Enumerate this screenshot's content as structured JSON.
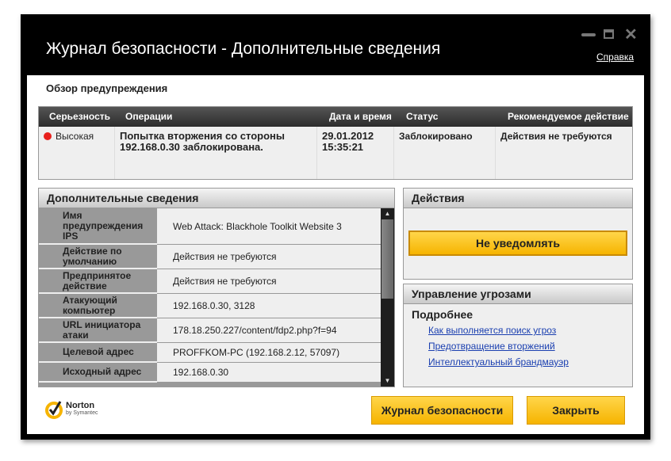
{
  "window": {
    "title": "Журнал безопасности - Дополнительные сведения",
    "help_link": "Справка"
  },
  "overview": {
    "heading": "Обзор предупреждения",
    "columns": [
      "Серьезность",
      "Операции",
      "Дата и время",
      "Статус",
      "Рекомендуемое действие"
    ],
    "row": {
      "severity": "Высокая",
      "severity_color": "#e8201c",
      "operation": "Попытка вторжения со стороны 192.168.0.30 заблокирована.",
      "date": "29.01.2012",
      "time": "15:35:21",
      "status": "Заблокировано",
      "recommended": "Действия не требуются"
    }
  },
  "details": {
    "heading": "Дополнительные сведения",
    "rows": [
      {
        "label": "Имя предупреждения IPS",
        "value": "Web Attack: Blackhole Toolkit Website 3"
      },
      {
        "label": "Действие по умолчанию",
        "value": "Действия не требуются"
      },
      {
        "label": "Предпринятое действие",
        "value": "Действия не требуются"
      },
      {
        "label": "Атакующий компьютер",
        "value": "192.168.0.30, 3128"
      },
      {
        "label": "URL инициатора атаки",
        "value": "178.18.250.227/content/fdp2.php?f=94"
      },
      {
        "label": "Целевой адрес",
        "value": "PROFFKOM-PC (192.168.2.12, 57097)"
      },
      {
        "label": "Исходный адрес",
        "value": "192.168.0.30"
      }
    ]
  },
  "actions": {
    "heading": "Действия",
    "button": "Не уведомлять"
  },
  "threats": {
    "heading": "Управление угрозами",
    "subheading": "Подробнее",
    "links": [
      "Как выполняется поиск угроз",
      "Предотвращение вторжений",
      "Интеллектуальный брандмауэр"
    ]
  },
  "footer": {
    "logo": "Norton by Symantec",
    "log_button": "Журнал безопасности",
    "close_button": "Закрыть"
  }
}
